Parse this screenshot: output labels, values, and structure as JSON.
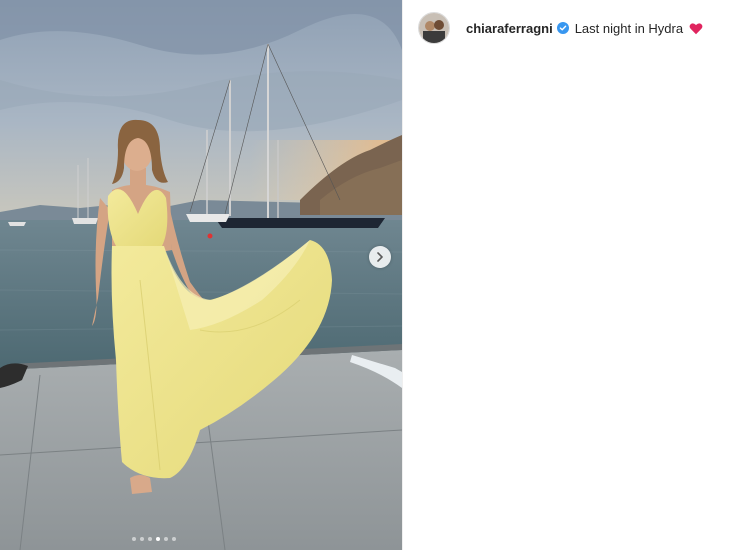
{
  "post": {
    "username": "chiaraferragni",
    "verified": true,
    "caption_text": "Last night in Hydra",
    "emoji": "red-heart",
    "carousel": {
      "count": 6,
      "active_index": 3
    }
  },
  "colors": {
    "verified_blue": "#3897f0",
    "heart_red": "#e0245e",
    "text": "#262626"
  },
  "icons": {
    "next": "chevron-right-icon",
    "verified": "verified-badge-icon",
    "emoji": "heart-emoji-icon"
  }
}
